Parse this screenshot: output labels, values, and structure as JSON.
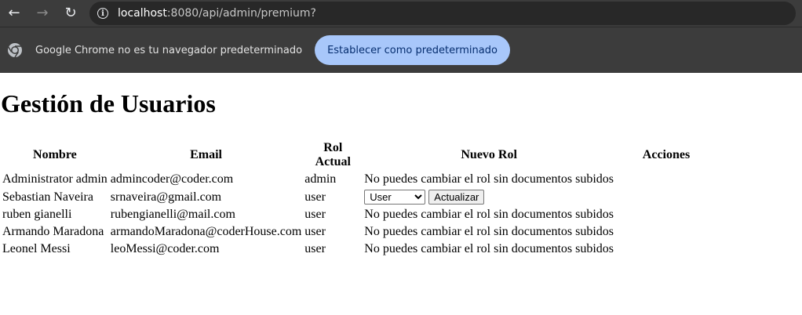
{
  "browser": {
    "url_host": "localhost",
    "url_rest": ":8080/api/admin/premium?",
    "back_icon": "back-arrow-icon",
    "forward_icon": "forward-arrow-icon",
    "reload_icon": "reload-icon",
    "info_icon": "info-icon"
  },
  "infobar": {
    "message": "Google Chrome no es tu navegador predeterminado",
    "button_label": "Establecer como predeterminado",
    "button_color": "#a8c7fa"
  },
  "page": {
    "title": "Gestión de Usuarios",
    "columns": [
      "Nombre",
      "Email",
      "Rol Actual",
      "Nuevo Rol",
      "Acciones"
    ],
    "rows": [
      {
        "nombre": "Administrator admin",
        "email": "admincoder@coder.com",
        "rol": "admin",
        "nuevo_rol": "No puedes cambiar el rol sin documentos subidos"
      },
      {
        "nombre": "Sebastian Naveira",
        "email": "srnaveira@gmail.com",
        "rol": "user",
        "select_value": "User",
        "button_label": "Actualizar"
      },
      {
        "nombre": "ruben gianelli",
        "email": "rubengianelli@mail.com",
        "rol": "user",
        "nuevo_rol": "No puedes cambiar el rol sin documentos subidos"
      },
      {
        "nombre": "Armando Maradona",
        "email": "armandoMaradona@coderHouse.com",
        "rol": "user",
        "nuevo_rol": "No puedes cambiar el rol sin documentos subidos"
      },
      {
        "nombre": "Leonel Messi",
        "email": "leoMessi@coder.com",
        "rol": "user",
        "nuevo_rol": "No puedes cambiar el rol sin documentos subidos"
      }
    ]
  }
}
